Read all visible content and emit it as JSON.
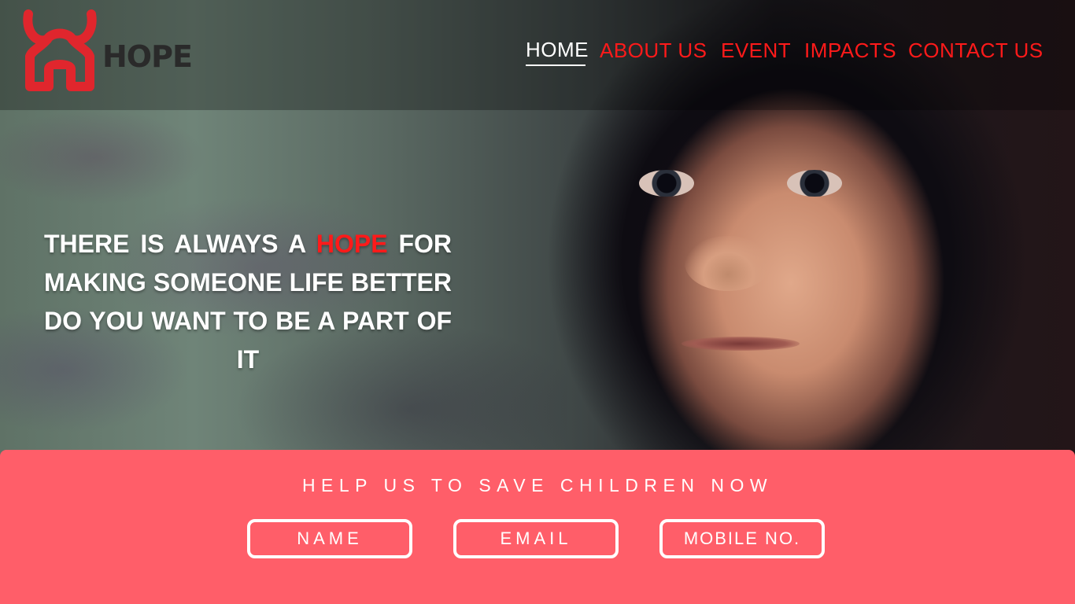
{
  "brand": {
    "name": "HOPE",
    "logo_color": "#e0262d"
  },
  "nav": {
    "items": [
      {
        "label": "HOME",
        "active": true
      },
      {
        "label": "ABOUT US",
        "active": false
      },
      {
        "label": "EVENT",
        "active": false
      },
      {
        "label": "IMPACTS",
        "active": false
      },
      {
        "label": "CONTACT US",
        "active": false
      }
    ],
    "accent_color": "#ff1a1a"
  },
  "hero": {
    "text_before": "THERE IS ALWAYS A ",
    "highlight": "HOPE",
    "text_after": " FOR MAKING SOMEONE LIFE BETTER DO YOU WANT TO BE A PART OF IT"
  },
  "form": {
    "title": "HELP US TO SAVE CHILDREN NOW",
    "background_color": "#ff5e69",
    "fields": {
      "name_placeholder": "NAME",
      "email_placeholder": "EMAIL",
      "mobile_placeholder": "MOBILE NO."
    }
  }
}
